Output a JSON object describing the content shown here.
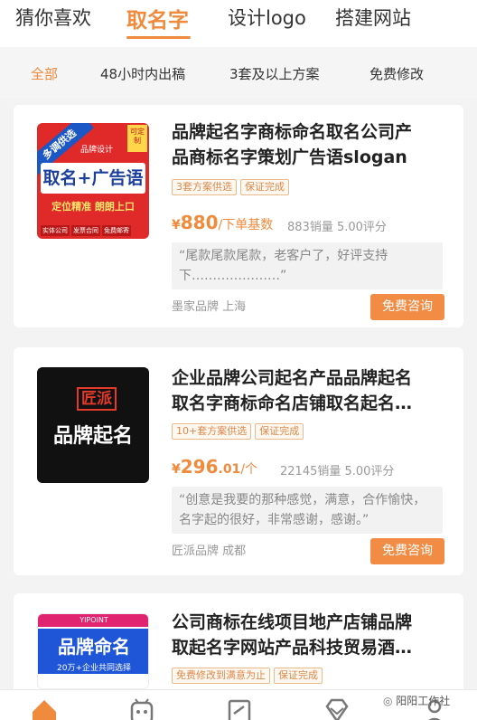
{
  "tabs": [
    {
      "label": "猜你喜欢",
      "active": false
    },
    {
      "label": "取名字",
      "active": true
    },
    {
      "label": "设计logo",
      "active": false
    },
    {
      "label": "搭建网站",
      "active": false
    }
  ],
  "filters": [
    {
      "label": "全部",
      "active": true
    },
    {
      "label": "48小时内出稿",
      "active": false
    },
    {
      "label": "3套及以上方案",
      "active": false
    },
    {
      "label": "免费修改",
      "active": false
    }
  ],
  "products": [
    {
      "title_line1": "品牌起名字商标命名取名公司产",
      "title_line2": "品商标名字策划广告语slogan",
      "tags": [
        "3套方案供选",
        "保证完成"
      ],
      "price_symbol": "¥",
      "price_int": "880",
      "price_dec": "",
      "price_unit": "/下单基数",
      "sales": "883销量 5.00评分",
      "review": "“尾款尾款尾款，老客户了，好评支持下…………………”",
      "seller": "墨家品牌 上海",
      "consult_label": "免费咨询",
      "thumb": {
        "ribbon": "多调供选",
        "brand": "品牌设计",
        "corner": "可定制",
        "headline": "取名+广告语",
        "slogan": "定位精准  朗朗上口",
        "chips": [
          "实体公司",
          "发票合同",
          "免费邮寄"
        ]
      }
    },
    {
      "title_line1": "企业品牌公司起名产品品牌起名",
      "title_line2": "取名字商标命名店铺取名起名…",
      "tags": [
        "10+套方案供选",
        "保证完成"
      ],
      "price_symbol": "¥",
      "price_int": "296",
      "price_dec": ".01",
      "price_unit": "/个",
      "sales": "22145销量 5.00评分",
      "review": "“创意是我要的那种感觉，满意，合作愉快，名字起的很好，非常感谢，感谢。”",
      "seller": "匠派品牌 成都",
      "consult_label": "免费咨询",
      "thumb": {
        "logo": "匠派",
        "headline": "品牌起名"
      }
    },
    {
      "title_line1": "公司商标在线项目地产店铺品牌",
      "title_line2": "取起名字网站产品科技贸易酒…",
      "tags": [
        "免费修改到满意为止",
        "保证完成"
      ],
      "thumb": {
        "brand": "YIPOINT",
        "headline": "品牌命名",
        "sub": "20万+企业共同选择"
      }
    }
  ],
  "watermark": "阳阳工作社",
  "colors": {
    "accent": "#f08a3c",
    "button": "#f28c44"
  }
}
